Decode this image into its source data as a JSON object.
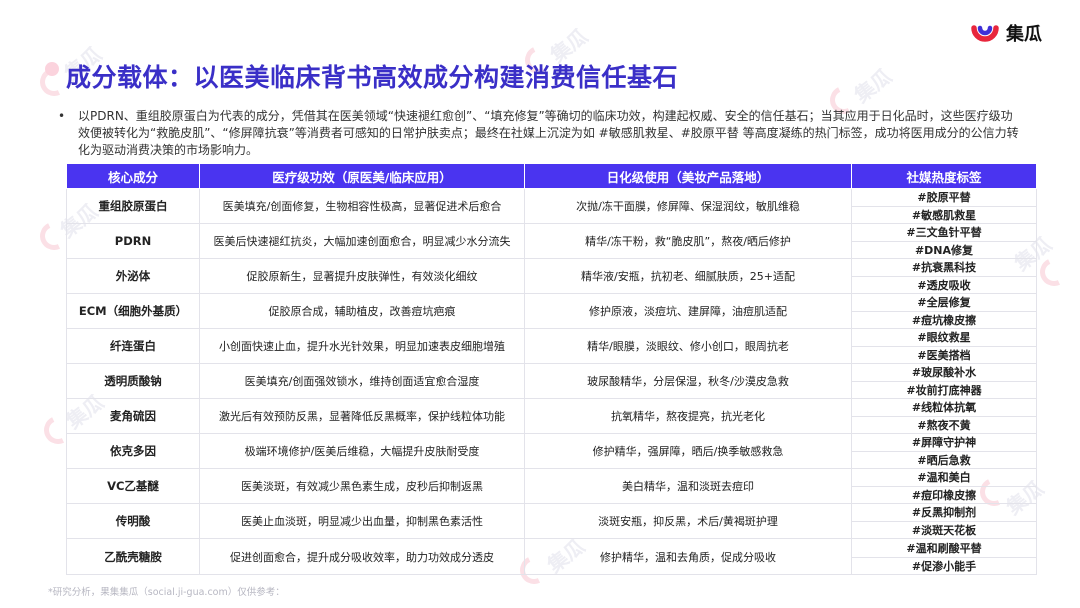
{
  "brand": {
    "name": "集瓜",
    "watermark": "集瓜"
  },
  "page": {
    "title": "成分载体：以医美临床背书高效成分构建消费信任基石",
    "intro": "以PDRN、重组胶原蛋白为代表的成分，凭借其在医美领域“快速褪红愈创”、“填充修复”等确切的临床功效，构建起权威、安全的信任基石；当其应用于日化品时，这些医疗级功效便被转化为“救脆皮肌”、“修屏障抗衰”等消费者可感知的日常护肤卖点；最终在社媒上沉淀为如 #敏感肌救星、#胶原平替 等高度凝练的热门标签，成功将医用成分的公信力转化为驱动消费决策的市场影响力。",
    "footnote": "*研究分析，果集集瓜（social.ji-gua.com）仅供参考："
  },
  "table": {
    "headers": [
      "核心成分",
      "医疗级功效（原医美/临床应用）",
      "日化级使用（美妆产品落地）",
      "社媒热度标签"
    ],
    "rows": [
      {
        "ingredient": "重组胶原蛋白",
        "medical": "医美填充/创面修复，生物相容性极高，显著促进术后愈合",
        "cosmetic": "次抛/冻干面膜，修屏障、保湿润纹，敏肌维稳",
        "tags": [
          "#胶原平替",
          "#敏感肌救星"
        ]
      },
      {
        "ingredient": "PDRN",
        "medical": "医美后快速褪红抗炎，大幅加速创面愈合，明显减少水分流失",
        "cosmetic": "精华/冻干粉，救“脆皮肌”，熬夜/晒后修护",
        "tags": [
          "#三文鱼针平替",
          "#DNA修复"
        ]
      },
      {
        "ingredient": "外泌体",
        "medical": "促胶原新生，显著提升皮肤弹性，有效淡化细纹",
        "cosmetic": "精华液/安瓶，抗初老、细腻肤质，25+适配",
        "tags": [
          "#抗衰黑科技",
          "#透皮吸收"
        ]
      },
      {
        "ingredient": "ECM（细胞外基质）",
        "medical": "促胶原合成，辅助植皮，改善痘坑疤痕",
        "cosmetic": "修护原液，淡痘坑、建屏障，油痘肌适配",
        "tags": [
          "#全层修复",
          "#痘坑橡皮擦"
        ]
      },
      {
        "ingredient": "纤连蛋白",
        "medical": "小创面快速止血，提升水光针效果，明显加速表皮细胞增殖",
        "cosmetic": "精华/眼膜，淡眼纹、修小创口，眼周抗老",
        "tags": [
          "#眼纹救星",
          "#医美搭档"
        ]
      },
      {
        "ingredient": "透明质酸钠",
        "medical": "医美填充/创面强效锁水，维持创面适宜愈合湿度",
        "cosmetic": "玻尿酸精华，分层保湿，秋冬/沙漠皮急救",
        "tags": [
          "#玻尿酸补水",
          "#妆前打底神器"
        ]
      },
      {
        "ingredient": "麦角硫因",
        "medical": "激光后有效预防反黑，显著降低反黑概率，保护线粒体功能",
        "cosmetic": "抗氧精华，熬夜提亮，抗光老化",
        "tags": [
          "#线粒体抗氧",
          "#熬夜不黄"
        ]
      },
      {
        "ingredient": "依克多因",
        "medical": "极端环境修护/医美后维稳，大幅提升皮肤耐受度",
        "cosmetic": "修护精华，强屏障，晒后/换季敏感救急",
        "tags": [
          "#屏障守护神",
          "#晒后急救"
        ]
      },
      {
        "ingredient": "VC乙基醚",
        "medical": "医美淡斑，有效减少黑色素生成，皮秒后抑制返黑",
        "cosmetic": "美白精华，温和淡斑去痘印",
        "tags": [
          "#温和美白",
          "#痘印橡皮擦"
        ]
      },
      {
        "ingredient": "传明酸",
        "medical": "医美止血淡斑，明显减少出血量，抑制黑色素活性",
        "cosmetic": "淡斑安瓶，抑反黑，术后/黄褐斑护理",
        "tags": [
          "#反黑抑制剂",
          "#淡斑天花板"
        ]
      },
      {
        "ingredient": "乙酰壳糖胺",
        "medical": "促进创面愈合，提升成分吸收效率，助力功效成分透皮",
        "cosmetic": "修护精华，温和去角质，促成分吸收",
        "tags": [
          "#温和刷酸平替",
          "#促渗小能手"
        ]
      }
    ]
  },
  "colors": {
    "title": "#3a2fc7",
    "header_bg": "#4a34f0",
    "accent_red": "#e8263c",
    "accent_blue": "#3f30d8"
  }
}
